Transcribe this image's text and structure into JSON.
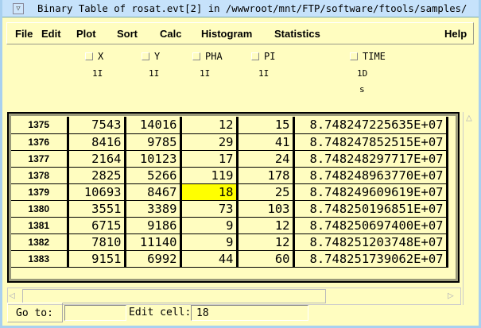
{
  "window": {
    "title": "Binary Table of rosat.evt[2] in /wwwroot/mnt/FTP/software/ftools/samples/"
  },
  "menu": [
    "File",
    "Edit",
    "Plot",
    "Sort",
    "Calc",
    "Histogram",
    "Statistics",
    "Help"
  ],
  "columns": [
    {
      "name": "X",
      "format": "1I",
      "unit": ""
    },
    {
      "name": "Y",
      "format": "1I",
      "unit": ""
    },
    {
      "name": "PHA",
      "format": "1I",
      "unit": ""
    },
    {
      "name": "PI",
      "format": "1I",
      "unit": ""
    },
    {
      "name": "TIME",
      "format": "1D",
      "unit": "s"
    }
  ],
  "rows": [
    [
      "1375",
      "7543",
      "14016",
      "12",
      "15",
      "8.748247225635E+07"
    ],
    [
      "1376",
      "8416",
      "9785",
      "29",
      "41",
      "8.748247852515E+07"
    ],
    [
      "1377",
      "2164",
      "10123",
      "17",
      "24",
      "8.748248297717E+07"
    ],
    [
      "1378",
      "2825",
      "5266",
      "119",
      "178",
      "8.748248963770E+07"
    ],
    [
      "1379",
      "10693",
      "8467",
      "18",
      "25",
      "8.748249609619E+07"
    ],
    [
      "1380",
      "3551",
      "3389",
      "73",
      "103",
      "8.748250196851E+07"
    ],
    [
      "1381",
      "6715",
      "9186",
      "9",
      "12",
      "8.748250697400E+07"
    ],
    [
      "1382",
      "7810",
      "11140",
      "9",
      "12",
      "8.748251203748E+07"
    ],
    [
      "1383",
      "9151",
      "6992",
      "44",
      "60",
      "8.748251739062E+07"
    ]
  ],
  "selected_cell": {
    "row": "1379",
    "column": "PHA"
  },
  "highlight_color": "#ffff00",
  "bottom": {
    "goto_label": "Go to:",
    "goto_value": "",
    "edit_label": "Edit cell:",
    "edit_value": "18"
  }
}
